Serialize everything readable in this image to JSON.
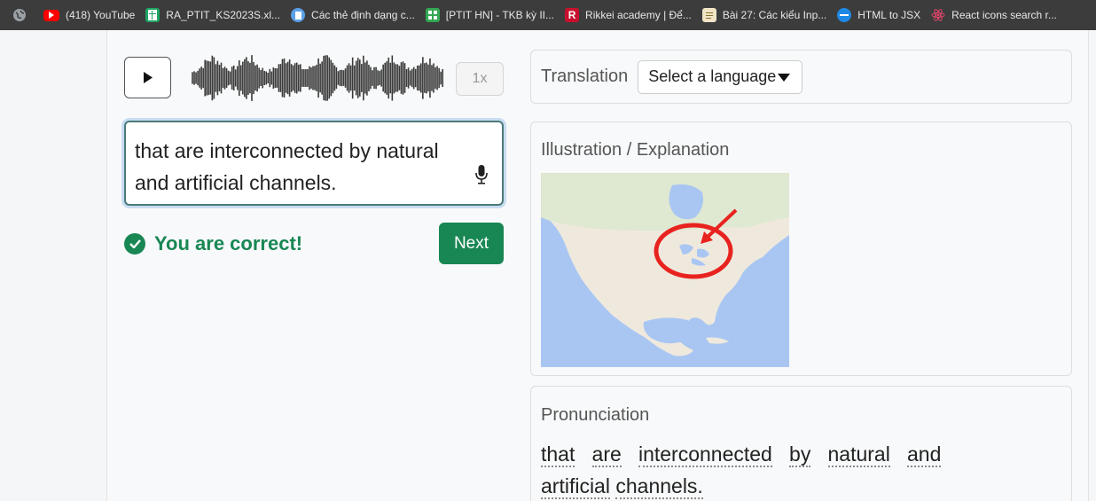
{
  "bookmarks": [
    {
      "label": "",
      "icon": "globe-icon"
    },
    {
      "label": "(418) YouTube",
      "icon": "youtube-icon"
    },
    {
      "label": "RA_PTIT_KS2023S.xl...",
      "icon": "sheets-icon"
    },
    {
      "label": "Các thẻ định dạng c...",
      "icon": "doc-icon"
    },
    {
      "label": "[PTIT HN] - TKB kỳ II...",
      "icon": "grid-icon"
    },
    {
      "label": "Rikkei academy | Để...",
      "icon": "rikkei-icon"
    },
    {
      "label": "Bài 27: Các kiểu Inp...",
      "icon": "page-icon"
    },
    {
      "label": "HTML to JSX",
      "icon": "transform-icon"
    },
    {
      "label": "React icons search r...",
      "icon": "react-icon"
    }
  ],
  "player": {
    "speed_label": "1x"
  },
  "answer": {
    "text": "that are interconnected by natural and artificial channels."
  },
  "result": {
    "message": "You are correct!",
    "next_label": "Next"
  },
  "translation": {
    "title": "Translation",
    "select_label": "Select a language"
  },
  "illustration": {
    "title": "Illustration / Explanation"
  },
  "pronunciation": {
    "title": "Pronunciation",
    "words": [
      "that",
      "are",
      "interconnected",
      "by",
      "natural",
      "and",
      "artificial",
      "channels."
    ]
  },
  "colors": {
    "success": "#198754",
    "bookmark_bar": "#3c3c3c"
  }
}
